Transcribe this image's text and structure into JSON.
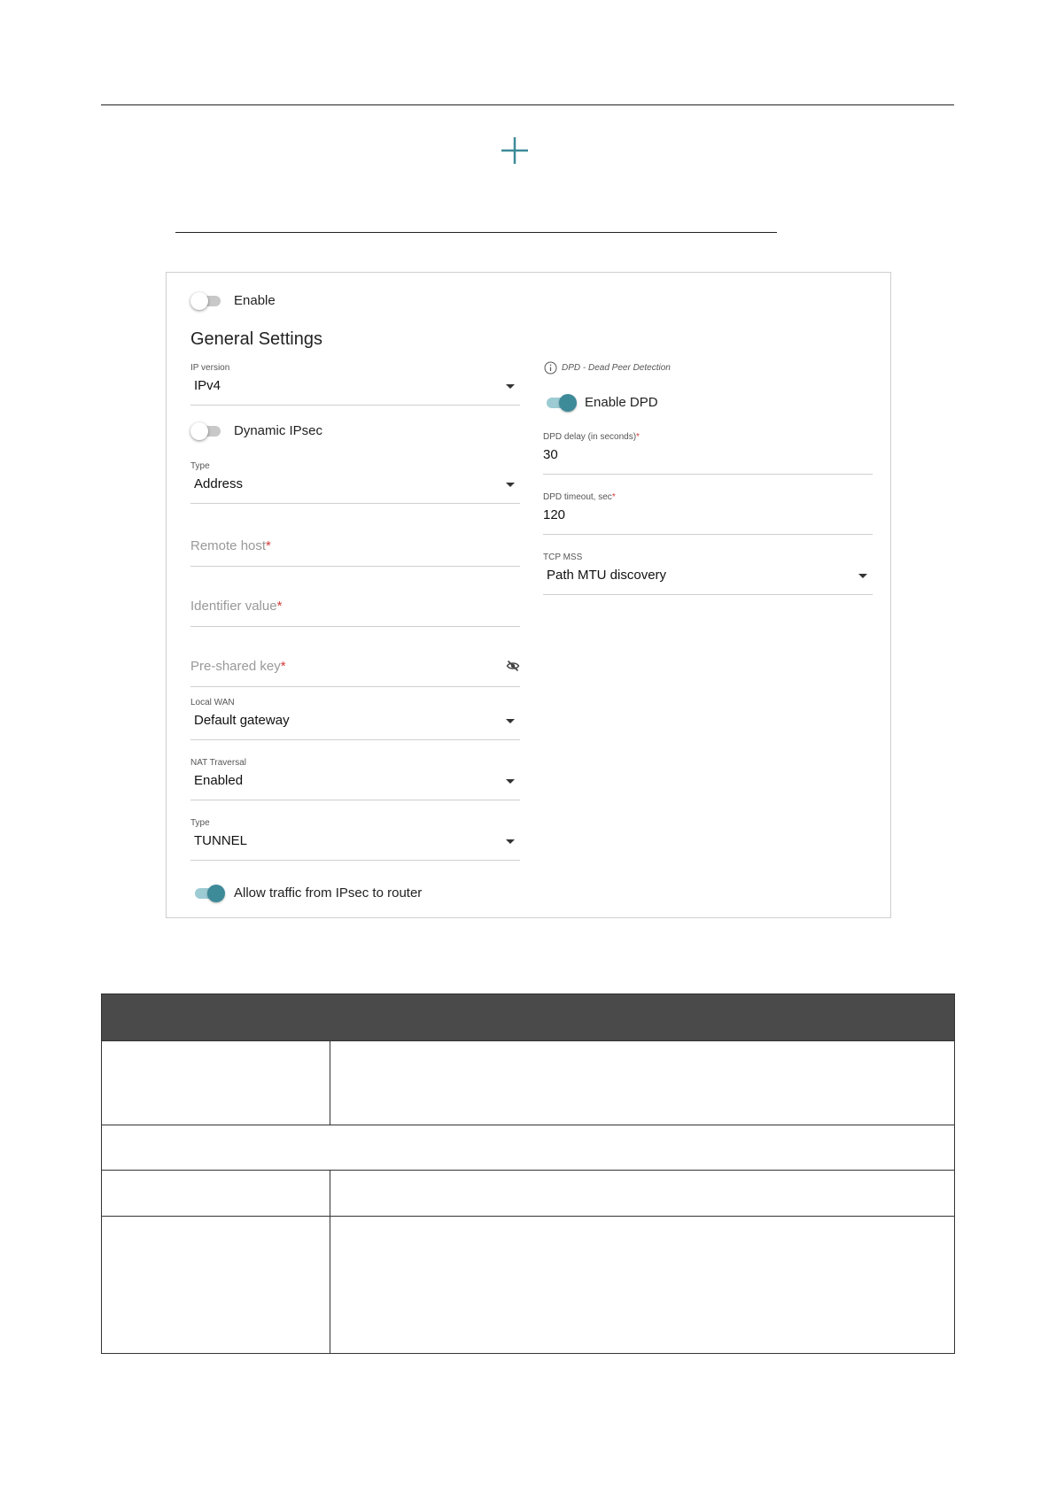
{
  "panel": {
    "enable_label": "Enable",
    "section_title": "General Settings",
    "left": {
      "ip_version": {
        "label": "IP version",
        "value": "IPv4"
      },
      "dynamic_ipsec_label": "Dynamic IPsec",
      "type": {
        "label": "Type",
        "value": "Address"
      },
      "remote_host": {
        "placeholder": "Remote host",
        "required_mark": "*"
      },
      "identifier_value": {
        "placeholder": "Identifier value",
        "required_mark": "*"
      },
      "pre_shared_key": {
        "placeholder": "Pre-shared key",
        "required_mark": "*",
        "icon": "eye-off-icon"
      },
      "local_wan": {
        "label": "Local WAN",
        "value": "Default gateway"
      },
      "nat_traversal": {
        "label": "NAT Traversal",
        "value": "Enabled"
      },
      "mode_type": {
        "label": "Type",
        "value": "TUNNEL"
      },
      "allow_traffic_label": "Allow traffic from IPsec to router"
    },
    "right": {
      "dpd_note": "DPD - Dead Peer Detection",
      "enable_dpd_label": "Enable DPD",
      "dpd_delay": {
        "label": "DPD delay (in seconds)",
        "required_mark": "*",
        "value": "30"
      },
      "dpd_timeout": {
        "label": "DPD timeout, sec",
        "required_mark": "*",
        "value": "120"
      },
      "tcp_mss": {
        "label": "TCP MSS",
        "value": "Path MTU discovery"
      }
    },
    "toggles": {
      "enable": false,
      "dynamic_ipsec": false,
      "enable_dpd": true,
      "allow_traffic": true
    }
  },
  "colors": {
    "accent": "#3d8a99",
    "required": "#d43b3b",
    "table_header": "#4a4a4a"
  }
}
